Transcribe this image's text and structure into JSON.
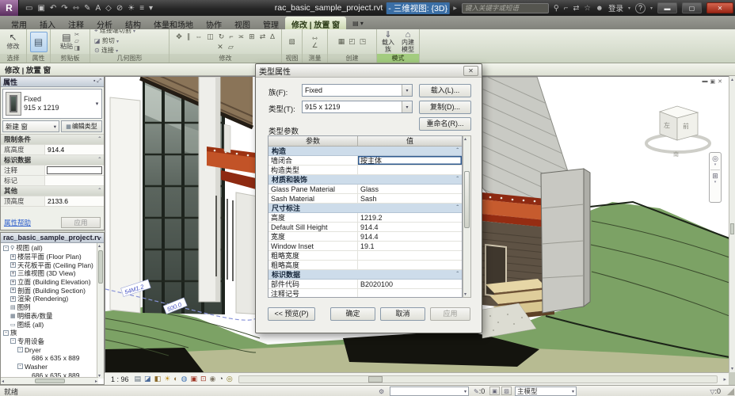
{
  "colors": {
    "active_tab_green": "#dde7c6",
    "contextual_panel_green": "#a3cc7f",
    "selection_blue": "#3a6ea5",
    "dialog_section_blue": "#cddcea",
    "canopy_red": "#b5431f",
    "terrain_green": "#7ca265",
    "close_button_red": "#b23a28"
  },
  "titlebar": {
    "doc_title": "rac_basic_sample_project.rvt",
    "view_title": "- 三维视图: {3D}",
    "search_placeholder": "键入关键字或短语",
    "signin_label": "登录",
    "help_glyph": "?",
    "qat_icons": [
      {
        "name": "open-icon",
        "glyph": "▭"
      },
      {
        "name": "save-icon",
        "glyph": "▣"
      },
      {
        "name": "undo-icon",
        "glyph": "↶"
      },
      {
        "name": "redo-icon",
        "glyph": "↷"
      },
      {
        "name": "measure-icon",
        "glyph": "⇿"
      },
      {
        "name": "draw-icon",
        "glyph": "✎"
      },
      {
        "name": "text-icon",
        "glyph": "A"
      },
      {
        "name": "view3d-icon",
        "glyph": "◇"
      },
      {
        "name": "section-icon",
        "glyph": "⊘"
      },
      {
        "name": "sun-icon",
        "glyph": "☀"
      },
      {
        "name": "thin-lines-icon",
        "glyph": "≡"
      },
      {
        "name": "qat-more-icon",
        "glyph": "▾"
      }
    ],
    "account_icons": [
      {
        "name": "search-icon",
        "glyph": "⚲"
      },
      {
        "name": "key-icon",
        "glyph": "⌐"
      },
      {
        "name": "exchange-icon",
        "glyph": "⇄"
      },
      {
        "name": "favorites-icon",
        "glyph": "☆"
      },
      {
        "name": "user-icon",
        "glyph": "☻"
      }
    ],
    "window_icons": [
      {
        "name": "minimize-icon",
        "glyph": "▬"
      },
      {
        "name": "maximize-icon",
        "glyph": "▢"
      },
      {
        "name": "close-icon",
        "glyph": "✕"
      }
    ]
  },
  "tabs": [
    {
      "label": "常用"
    },
    {
      "label": "插入"
    },
    {
      "label": "注释"
    },
    {
      "label": "分析"
    },
    {
      "label": "结构"
    },
    {
      "label": "体量和场地"
    },
    {
      "label": "协作"
    },
    {
      "label": "视图"
    },
    {
      "label": "管理"
    },
    {
      "label": "修改 | 放置 窗",
      "active": true
    }
  ],
  "tabbar_menu_glyph": "▤ ▾",
  "ribbon": {
    "select": {
      "label": "选择",
      "button": "修改",
      "icon": "↖"
    },
    "properties": {
      "label": "属性",
      "icon": "▤"
    },
    "clipboard": {
      "label": "剪贴板",
      "paste": "粘贴",
      "paste_icon": "▤",
      "icons": [
        {
          "name": "cut-icon",
          "glyph": "✂"
        },
        {
          "name": "copy-icon",
          "glyph": "▱"
        },
        {
          "name": "match-icon",
          "glyph": "◨"
        }
      ]
    },
    "geometry": {
      "label": "几何图形",
      "items": [
        {
          "glyph": "⌖",
          "label": "连接端切割"
        },
        {
          "glyph": "◪",
          "label": "剪切"
        },
        {
          "glyph": "⊙",
          "label": "连接"
        }
      ]
    },
    "modify": {
      "label": "修改",
      "icons": [
        {
          "name": "move-icon",
          "glyph": "✥"
        },
        {
          "name": "align-icon",
          "glyph": "∥"
        },
        {
          "name": "offset-icon",
          "glyph": "⇔"
        },
        {
          "name": "mirror-icon",
          "glyph": "◫"
        },
        {
          "name": "rotate-icon",
          "glyph": "↻"
        },
        {
          "name": "trim-icon",
          "glyph": "⌐"
        },
        {
          "name": "split-icon",
          "glyph": "≍"
        },
        {
          "name": "array-icon",
          "glyph": "⊞"
        },
        {
          "name": "scale-icon",
          "glyph": "⇄"
        },
        {
          "name": "pin-icon",
          "glyph": "∆"
        },
        {
          "name": "delete-icon",
          "glyph": "✕"
        },
        {
          "name": "paste2-icon",
          "glyph": "▱"
        }
      ]
    },
    "view": {
      "label": "视图",
      "icons": [
        {
          "name": "hide-elements-icon",
          "glyph": "▧"
        }
      ]
    },
    "measure": {
      "label": "测量",
      "icons": [
        {
          "name": "measure-dist-icon",
          "glyph": "⇿"
        },
        {
          "name": "measure-angle-icon",
          "glyph": "∠"
        }
      ]
    },
    "create": {
      "label": "创建",
      "icons": [
        {
          "name": "group-icon",
          "glyph": "▦"
        },
        {
          "name": "assembly-icon",
          "glyph": "◰"
        },
        {
          "name": "parts-icon",
          "glyph": "◳"
        }
      ]
    },
    "mode": {
      "label": "模式",
      "buttons": [
        {
          "glyph": "⇓",
          "line1": "载入",
          "line2": "族"
        },
        {
          "glyph": "⌂",
          "line1": "内建",
          "line2": "模型"
        }
      ]
    }
  },
  "options_bar": {
    "label": "修改 | 放置 窗"
  },
  "props": {
    "header": "属性",
    "type_name": "Fixed",
    "type_size": "915 x 1219",
    "selector_new": "新建 窗",
    "edit_type": "编辑类型",
    "rows": [
      {
        "type": "psec",
        "label": "限制条件",
        "value": ""
      },
      {
        "type": "prow",
        "label": "底高度",
        "value": "914.4"
      },
      {
        "type": "psec",
        "label": "标识数据",
        "value": ""
      },
      {
        "type": "prow",
        "label": "注释",
        "value": "",
        "input": true
      },
      {
        "type": "prow",
        "label": "标记",
        "value": ""
      },
      {
        "type": "psec",
        "label": "其他",
        "value": ""
      },
      {
        "type": "prow",
        "label": "顶高度",
        "value": "2133.6"
      }
    ],
    "help_link": "属性帮助",
    "apply_label": "应用"
  },
  "browser": {
    "header": "rac_basic_sample_project.rvt - ...",
    "items": [
      {
        "indent": 0,
        "exp": "-",
        "icon": "⚲",
        "label": "视图 (all)"
      },
      {
        "indent": 1,
        "exp": "+",
        "icon": "",
        "label": "楼层平面 (Floor Plan)"
      },
      {
        "indent": 1,
        "exp": "+",
        "icon": "",
        "label": "天花板平面 (Ceiling Plan)"
      },
      {
        "indent": 1,
        "exp": "+",
        "icon": "",
        "label": "三维视图 (3D View)"
      },
      {
        "indent": 1,
        "exp": "+",
        "icon": "",
        "label": "立面 (Building Elevation)"
      },
      {
        "indent": 1,
        "exp": "+",
        "icon": "",
        "label": "剖面 (Building Section)"
      },
      {
        "indent": 1,
        "exp": "+",
        "icon": "",
        "label": "渲染 (Rendering)"
      },
      {
        "indent": 0,
        "exp": "",
        "icon": "▤",
        "label": "图例"
      },
      {
        "indent": 0,
        "exp": "",
        "icon": "▦",
        "label": "明细表/数量"
      },
      {
        "indent": 0,
        "exp": "",
        "icon": "▭",
        "label": "图纸 (all)"
      },
      {
        "indent": 0,
        "exp": "-",
        "icon": "",
        "label": "族"
      },
      {
        "indent": 1,
        "exp": "-",
        "icon": "",
        "label": "专用设备"
      },
      {
        "indent": 2,
        "exp": "-",
        "icon": "",
        "label": "Dryer"
      },
      {
        "indent": 3,
        "exp": "",
        "icon": "",
        "label": "686 x 635 x 889"
      },
      {
        "indent": 2,
        "exp": "-",
        "icon": "",
        "label": "Washer"
      },
      {
        "indent": 3,
        "exp": "",
        "icon": "",
        "label": "686 x 635 x 889"
      }
    ]
  },
  "dialog": {
    "title": "类型属性",
    "family_label": "族(F):",
    "family_value": "Fixed",
    "load_btn": "载入(L)...",
    "type_label": "类型(T):",
    "type_value": "915 x 1219",
    "duplicate_btn": "复制(D)...",
    "rename_btn": "重命名(R)...",
    "params_label": "类型参数",
    "col_param": "参数",
    "col_value": "值",
    "rows": [
      {
        "type": "section",
        "label": "构造",
        "value": ""
      },
      {
        "type": "row",
        "label": "墙闭合",
        "value": "按主体",
        "selected": true
      },
      {
        "type": "row",
        "label": "构造类型",
        "value": ""
      },
      {
        "type": "section",
        "label": "材质和装饰",
        "value": ""
      },
      {
        "type": "row",
        "label": "Glass Pane Material",
        "value": "Glass"
      },
      {
        "type": "row",
        "label": "Sash Material",
        "value": "Sash"
      },
      {
        "type": "section",
        "label": "尺寸标注",
        "value": ""
      },
      {
        "type": "row",
        "label": "高度",
        "value": "1219.2"
      },
      {
        "type": "row",
        "label": "Default Sill Height",
        "value": "914.4"
      },
      {
        "type": "row",
        "label": "宽度",
        "value": "914.4"
      },
      {
        "type": "row",
        "label": "Window Inset",
        "value": "19.1"
      },
      {
        "type": "row",
        "label": "粗略宽度",
        "value": ""
      },
      {
        "type": "row",
        "label": "粗略高度",
        "value": ""
      },
      {
        "type": "section",
        "label": "标识数据",
        "value": ""
      },
      {
        "type": "row",
        "label": "部件代码",
        "value": "B2020100"
      },
      {
        "type": "row",
        "label": "注释记号",
        "value": ""
      }
    ],
    "preview_btn": "<< 预览(P)",
    "ok_btn": "确定",
    "cancel_btn": "取消",
    "apply_btn": "应用"
  },
  "viewport": {
    "scale": "1 : 96",
    "view_icons": [
      {
        "name": "graphics-options-icon",
        "glyph": "▤",
        "color": "#5a6a78"
      },
      {
        "name": "detail-level-icon",
        "glyph": "◪",
        "color": "#4a6a9a"
      },
      {
        "name": "visual-style-icon",
        "glyph": "◧",
        "color": "#8a6a2a"
      },
      {
        "name": "sun-path-icon",
        "glyph": "☀",
        "color": "#c09020"
      },
      {
        "name": "shadows-icon",
        "glyph": "◐",
        "color": "#907040"
      },
      {
        "name": "rendering-icon",
        "glyph": "◍",
        "color": "#4a7ab5"
      },
      {
        "name": "crop-view-icon",
        "glyph": "▣",
        "color": "#a03828"
      },
      {
        "name": "crop-region-icon",
        "glyph": "⊡",
        "color": "#a03828"
      },
      {
        "name": "lock-3d-icon",
        "glyph": "◉",
        "color": "#807868"
      },
      {
        "name": "hide-isolate-icon",
        "glyph": "◔",
        "color": "#3a3a3a"
      },
      {
        "name": "reveal-hidden-icon",
        "glyph": "◎",
        "color": "#887820"
      }
    ],
    "tag1": "54M1.2",
    "tag2": "500.0",
    "viewcube": {
      "left": "左",
      "front": "前",
      "south": "南"
    }
  },
  "statusbar": {
    "ready": "就绪",
    "editable_suffix": ":0",
    "design_option": "主模型",
    "filter_suffix": ":0"
  }
}
